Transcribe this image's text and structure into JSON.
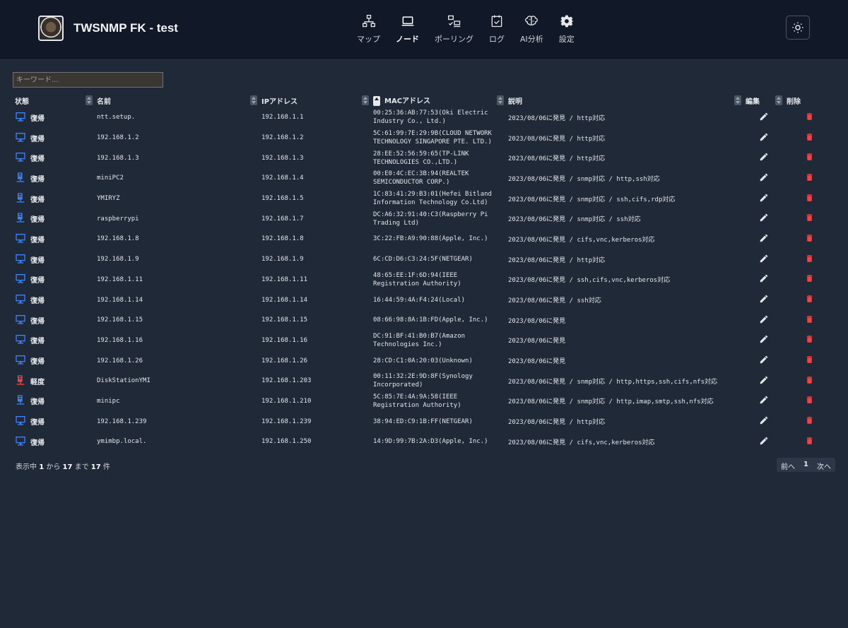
{
  "app": {
    "title": "TWSNMP FK - test"
  },
  "nav": [
    {
      "key": "map",
      "label": "マップ",
      "icon": "sitemap-icon",
      "active": false
    },
    {
      "key": "node",
      "label": "ノード",
      "icon": "laptop-icon",
      "active": true
    },
    {
      "key": "polling",
      "label": "ポーリング",
      "icon": "polling-icon",
      "active": false
    },
    {
      "key": "log",
      "label": "ログ",
      "icon": "calendar-check-icon",
      "active": false
    },
    {
      "key": "ai",
      "label": "AI分析",
      "icon": "brain-icon",
      "active": false
    },
    {
      "key": "settings",
      "label": "設定",
      "icon": "gear-icon",
      "active": false
    }
  ],
  "search": {
    "placeholder": "キーワード..."
  },
  "columns": {
    "state": "状態",
    "name": "名前",
    "ip": "IPアドレス",
    "mac": "MACアドレス",
    "descr": "説明",
    "edit": "編集",
    "delete": "削除"
  },
  "colors": {
    "repair": "#3b82f6",
    "low": "#ef4444",
    "delete": "#ef4444"
  },
  "rows": [
    {
      "icon": "desktop",
      "state": "復帰",
      "name": "ntt.setup.",
      "ip": "192.168.1.1",
      "mac": "00:25:36:AB:77:53(Oki Electric Industry Co., Ltd.)",
      "descr": "2023/08/06に発見 / http対応"
    },
    {
      "icon": "desktop",
      "state": "復帰",
      "name": "192.168.1.2",
      "ip": "192.168.1.2",
      "mac": "5C:61:99:7E:29:9B(CLOUD NETWORK TECHNOLOGY SINGAPORE PTE. LTD.)",
      "descr": "2023/08/06に発見 / http対応"
    },
    {
      "icon": "desktop",
      "state": "復帰",
      "name": "192.168.1.3",
      "ip": "192.168.1.3",
      "mac": "28:EE:52:56:59:65(TP-LINK TECHNOLOGIES CO.,LTD.)",
      "descr": "2023/08/06に発見 / http対応"
    },
    {
      "icon": "server",
      "state": "復帰",
      "name": "miniPC2",
      "ip": "192.168.1.4",
      "mac": "00:E0:4C:EC:3B:94(REALTEK SEMICONDUCTOR CORP.)",
      "descr": "2023/08/06に発見 / snmp対応 / http,ssh対応"
    },
    {
      "icon": "server",
      "state": "復帰",
      "name": "YMIRYZ",
      "ip": "192.168.1.5",
      "mac": "1C:83:41:29:B3:01(Hefei Bitland Information Technology Co.Ltd)",
      "descr": "2023/08/06に発見 / snmp対応 / ssh,cifs,rdp対応"
    },
    {
      "icon": "server",
      "state": "復帰",
      "name": "raspberrypi",
      "ip": "192.168.1.7",
      "mac": "DC:A6:32:91:40:C3(Raspberry Pi Trading Ltd)",
      "descr": "2023/08/06に発見 / snmp対応 / ssh対応"
    },
    {
      "icon": "desktop",
      "state": "復帰",
      "name": "192.168.1.8",
      "ip": "192.168.1.8",
      "mac": "3C:22:FB:A9:90:88(Apple, Inc.)",
      "descr": "2023/08/06に発見 / cifs,vnc,kerberos対応"
    },
    {
      "icon": "desktop",
      "state": "復帰",
      "name": "192.168.1.9",
      "ip": "192.168.1.9",
      "mac": "6C:CD:D6:C3:24:5F(NETGEAR)",
      "descr": "2023/08/06に発見 / http対応"
    },
    {
      "icon": "desktop",
      "state": "復帰",
      "name": "192.168.1.11",
      "ip": "192.168.1.11",
      "mac": "48:65:EE:1F:6D:94(IEEE Registration Authority)",
      "descr": "2023/08/06に発見 / ssh,cifs,vnc,kerberos対応"
    },
    {
      "icon": "desktop",
      "state": "復帰",
      "name": "192.168.1.14",
      "ip": "192.168.1.14",
      "mac": "16:44:59:4A:F4:24(Local)",
      "descr": "2023/08/06に発見 / ssh対応"
    },
    {
      "icon": "desktop",
      "state": "復帰",
      "name": "192.168.1.15",
      "ip": "192.168.1.15",
      "mac": "08:66:98:8A:1B:FD(Apple, Inc.)",
      "descr": "2023/08/06に発見"
    },
    {
      "icon": "desktop",
      "state": "復帰",
      "name": "192.168.1.16",
      "ip": "192.168.1.16",
      "mac": "DC:91:BF:41:B0:B7(Amazon Technologies Inc.)",
      "descr": "2023/08/06に発見"
    },
    {
      "icon": "desktop",
      "state": "復帰",
      "name": "192.168.1.26",
      "ip": "192.168.1.26",
      "mac": "28:CD:C1:0A:20:03(Unknown)",
      "descr": "2023/08/06に発見"
    },
    {
      "icon": "server-warn",
      "state": "軽度",
      "name": "DiskStationYMI",
      "ip": "192.168.1.203",
      "mac": "00:11:32:2E:9D:8F(Synology Incorporated)",
      "descr": "2023/08/06に発見 / snmp対応 / http,https,ssh,cifs,nfs対応"
    },
    {
      "icon": "server",
      "state": "復帰",
      "name": "minipc",
      "ip": "192.168.1.210",
      "mac": "5C:85:7E:4A:9A:58(IEEE Registration Authority)",
      "descr": "2023/08/06に発見 / snmp対応 / http,imap,smtp,ssh,nfs対応"
    },
    {
      "icon": "desktop",
      "state": "復帰",
      "name": "192.168.1.239",
      "ip": "192.168.1.239",
      "mac": "38:94:ED:C9:1B:FF(NETGEAR)",
      "descr": "2023/08/06に発見 / http対応"
    },
    {
      "icon": "desktop",
      "state": "復帰",
      "name": "ymimbp.local.",
      "ip": "192.168.1.250",
      "mac": "14:9D:99:7B:2A:D3(Apple, Inc.)",
      "descr": "2023/08/06に発見 / cifs,vnc,kerberos対応"
    }
  ],
  "footer": {
    "prefix": "表示中 ",
    "from": "1",
    "mid1": " から ",
    "to": "17",
    "mid2": " まで ",
    "total": "17",
    "suffix": " 件"
  },
  "pager": {
    "prev": "前へ",
    "page": "1",
    "next": "次へ"
  }
}
